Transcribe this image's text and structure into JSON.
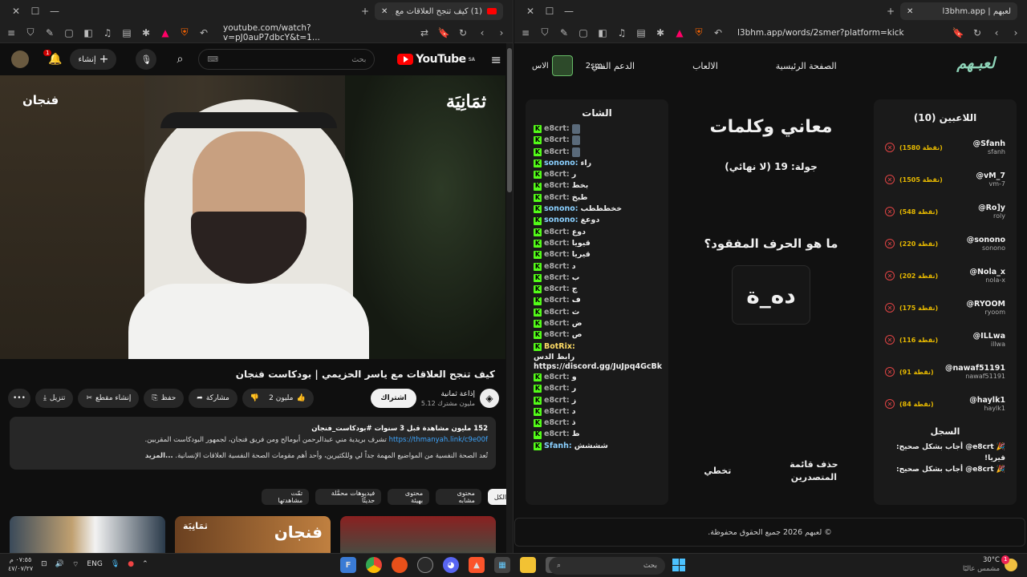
{
  "left_window": {
    "tab_title": "(1) كيف تنجح العلاقات مع ياسر",
    "url": "youtube.com/watch?v=pJ0auP7dbcY&t=1...",
    "youtube": {
      "create_label": "إنشاء",
      "search_placeholder": "بحث",
      "logo_text": "YouTube",
      "region": "SA",
      "notif_count": "1"
    },
    "video": {
      "brand_left": "ثمَانِيَة",
      "brand_right": "فنجان",
      "title": "كيف تنجح العلاقات مع ياسر الحزيمي | بودكاست فنجان",
      "channel_name": "إذاعة ثمانية",
      "channel_subs": "5.12 مليون مشترك",
      "subscribe_label": "اشتراك",
      "likes": "2 مليون",
      "share_label": "مشاركة",
      "save_label": "حفظ",
      "clip_label": "إنشاء مقطع",
      "download_label": "تنزيل"
    },
    "description": {
      "meta": "152 مليون مشاهدة  قبل 3 سنوات  #بودكاست_فنجان",
      "line1": "تشرف بريدية مني عبدالرحمن أبومالح ومن فريق فنجان، لجمهور البودكاست المقربين.",
      "link": "https://thmanyah.link/c9e00f",
      "line2": "تُعد الصحة النفسية من المواضيع المهمة جداً لي وللكثيرين، وأحد أهم مقومات الصحة النفسية العلاقات الإنسانية.",
      "more": "...المزيد"
    },
    "chips": [
      "الكل",
      "محتوى مشابه",
      "محتوى بهيئة",
      "فيديوهات محمَّلة حديثًا",
      "تمّت مشاهدتها"
    ],
    "thumbs": [
      "video-thumb-1",
      "video-thumb-2",
      "video-thumb-3"
    ],
    "thumb_caption_2": "ثمَانِيَة",
    "thumb_caption_2b": "فنجان"
  },
  "right_window": {
    "tab_title": "لعبهم | l3bhm.app",
    "url": "l3bhm.app/words/2smer?platform=kick",
    "nav": {
      "home": "الصفحة الرئيسية",
      "games": "الالعاب",
      "support": "الدعم الفني",
      "more": "الاس",
      "user": "2sm",
      "logo": "لعبـهم"
    },
    "chat": {
      "title": "الشات",
      "messages": [
        {
          "user": "e8crt:",
          "text": "",
          "emoji": true,
          "style": ""
        },
        {
          "user": "e8crt:",
          "text": "",
          "emoji": true,
          "style": ""
        },
        {
          "user": "e8crt:",
          "text": "",
          "emoji": true,
          "style": ""
        },
        {
          "user": "sonono:",
          "text": "راء",
          "emoji": false,
          "style": "alt"
        },
        {
          "user": "e8crt:",
          "text": "ر",
          "emoji": false,
          "style": ""
        },
        {
          "user": "e8crt:",
          "text": "بخط",
          "emoji": false,
          "style": ""
        },
        {
          "user": "e8crt:",
          "text": "طبخ",
          "emoji": false,
          "style": ""
        },
        {
          "user": "sonono:",
          "text": "خخطططب",
          "emoji": false,
          "style": "alt"
        },
        {
          "user": "sonono:",
          "text": "دوعغ",
          "emoji": false,
          "style": "alt"
        },
        {
          "user": "e8crt:",
          "text": "دوع",
          "emoji": false,
          "style": ""
        },
        {
          "user": "e8crt:",
          "text": "قيويا",
          "emoji": false,
          "style": ""
        },
        {
          "user": "e8crt:",
          "text": "قيريا",
          "emoji": false,
          "style": ""
        },
        {
          "user": "e8crt:",
          "text": "د",
          "emoji": false,
          "style": ""
        },
        {
          "user": "e8crt:",
          "text": "ب",
          "emoji": false,
          "style": ""
        },
        {
          "user": "e8crt:",
          "text": "ج",
          "emoji": false,
          "style": ""
        },
        {
          "user": "e8crt:",
          "text": "ف",
          "emoji": false,
          "style": ""
        },
        {
          "user": "e8crt:",
          "text": "ث",
          "emoji": false,
          "style": ""
        },
        {
          "user": "e8crt:",
          "text": "ض",
          "emoji": false,
          "style": ""
        },
        {
          "user": "e8crt:",
          "text": "ص",
          "emoji": false,
          "style": ""
        }
      ],
      "bot_user": "BotRix:",
      "bot_text_1": "رابط الدس",
      "bot_text_2": "https://discord.gg/JuJpq4GcBk",
      "messages2": [
        {
          "user": "e8crt:",
          "text": "و"
        },
        {
          "user": "e8crt:",
          "text": "ر"
        },
        {
          "user": "e8crt:",
          "text": "ز"
        },
        {
          "user": "e8crt:",
          "text": "د"
        },
        {
          "user": "e8crt:",
          "text": "ذ"
        },
        {
          "user": "e8crt:",
          "text": "ط"
        }
      ],
      "last_user": "Sfanh:",
      "last_text": "شششش"
    },
    "game": {
      "title": "معاني وكلمات",
      "round": "جولة: 19 (لا نهائي)",
      "question": "ما هو الحرف المفقود؟",
      "word": "ده_ة",
      "skip_label": "تخطي",
      "clear_label_1": "حذف قائمة",
      "clear_label_2": "المتصدرين"
    },
    "players": {
      "title": "اللاعبين (10)",
      "list": [
        {
          "display": "@Sfanh",
          "username": "sfanh",
          "points": "(1580 نقطة)"
        },
        {
          "display": "@vM_7",
          "username": "vm-7",
          "points": "(1505 نقطة)"
        },
        {
          "display": "@Ro]y",
          "username": "roly",
          "points": "(548 نقطة)"
        },
        {
          "display": "@sonono",
          "username": "sonono",
          "points": "(220 نقطة)"
        },
        {
          "display": "@Nola_x",
          "username": "nola-x",
          "points": "(202 نقطة)"
        },
        {
          "display": "@RYOOM",
          "username": "ryoom",
          "points": "(175 نقطة)"
        },
        {
          "display": "@ILLwa",
          "username": "illwa",
          "points": "(116 نقطة)"
        },
        {
          "display": "@nawaf51191",
          "username": "nawaf51191",
          "points": "(91 نقطة)"
        },
        {
          "display": "@haylk1",
          "username": "haylk1",
          "points": "(84 نقطة)"
        }
      ],
      "log_title": "السجل",
      "log": [
        "🎉 e8crt@ أجاب بشكل صحيح: قيريا!",
        "🎉 e8crt@ أجاب بشكل صحيح:"
      ]
    },
    "footer": "© لعبهم 2026 جميع الحقوق محفوظة."
  },
  "taskbar": {
    "time": "٠٧:٥٥ م",
    "date": "٤٧/٠٧/٢٧",
    "lang": "ENG",
    "search_placeholder": "بحث",
    "temp": "30°C",
    "weather_text": "مشمس عالبًا",
    "weather_badge": "1"
  },
  "colors": {
    "kick_green": "#53fc18",
    "youtube_red": "#ff0000",
    "points_gold": "#e6b800",
    "remove_red": "#e04444",
    "logo_teal": "#8ed3b8"
  }
}
